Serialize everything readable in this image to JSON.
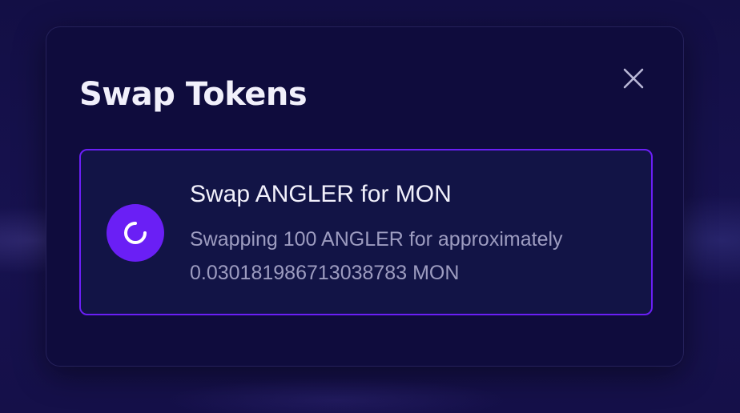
{
  "modal": {
    "title": "Swap Tokens",
    "close_icon": "close-x-icon"
  },
  "status": {
    "icon": "loading-spinner-icon",
    "title": "Swap ANGLER for MON",
    "description_line1": "Swapping 100 ANGLER for approximately",
    "description_line2": "0.030181986713038783 MON"
  },
  "colors": {
    "accent": "#6a1ff5",
    "modal_bg": "#0f0c3d",
    "card_bg": "#121446",
    "title_text": "#f1f0fb",
    "muted_text": "#9d9cc0"
  }
}
